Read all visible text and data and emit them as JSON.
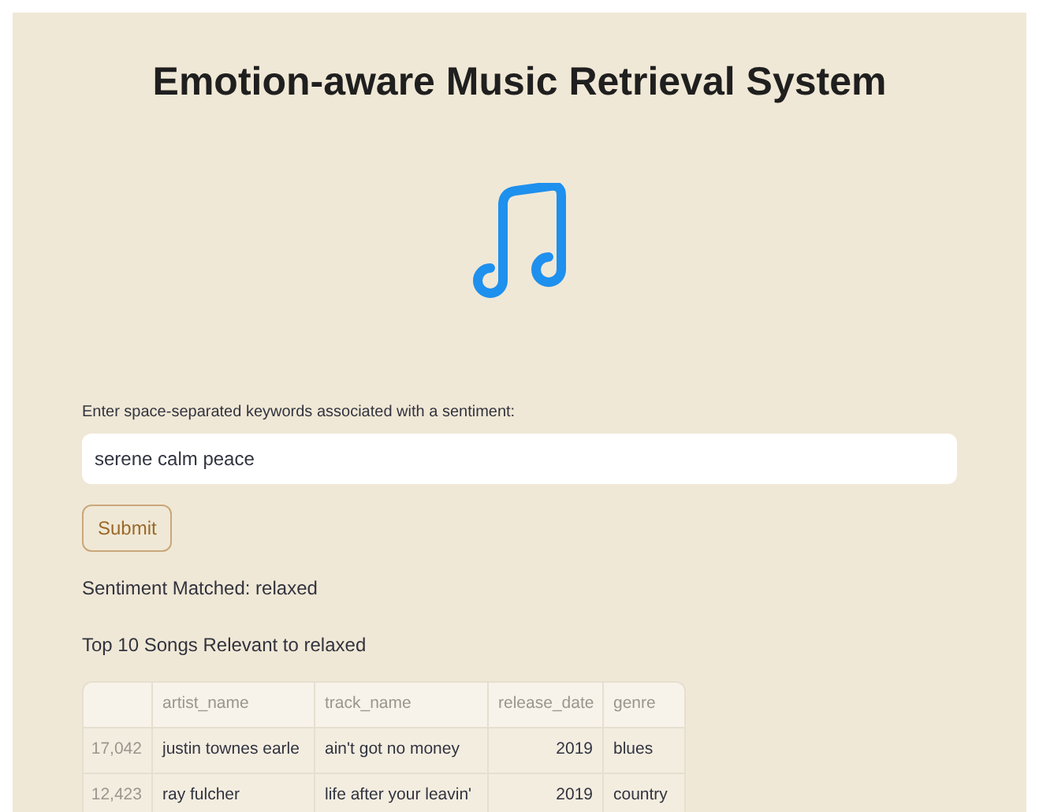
{
  "title": "Emotion-aware Music Retrieval System",
  "input": {
    "label": "Enter space-separated keywords associated with a sentiment:",
    "value": "serene calm peace"
  },
  "submit_button": "Submit",
  "sentiment_text": "Sentiment Matched: relaxed",
  "results_heading": "Top 10 Songs Relevant to relaxed",
  "table": {
    "columns": [
      "",
      "artist_name",
      "track_name",
      "release_date",
      "genre"
    ],
    "rows": [
      {
        "index": "17,042",
        "artist_name": "justin townes earle",
        "track_name": "ain't got no money",
        "release_date": "2019",
        "genre": "blues"
      },
      {
        "index": "12,423",
        "artist_name": "ray fulcher",
        "track_name": "life after your leavin'",
        "release_date": "2019",
        "genre": "country"
      }
    ]
  }
}
